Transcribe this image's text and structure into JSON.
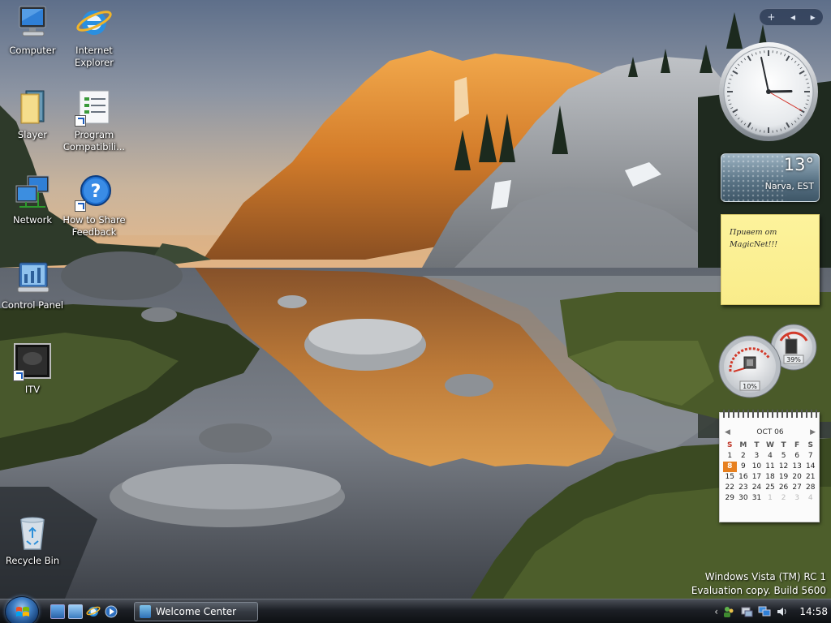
{
  "desktop": {
    "icons": [
      {
        "label": "Computer",
        "icon": "computer-icon"
      },
      {
        "label": "Internet\nExplorer",
        "icon": "internet-explorer-icon"
      },
      {
        "label": "Slayer",
        "icon": "folder-icon"
      },
      {
        "label": "Program\nCompatibili...",
        "icon": "program-compatibility-icon"
      },
      {
        "label": "Network",
        "icon": "network-icon"
      },
      {
        "label": "How to Share\nFeedback",
        "icon": "help-icon"
      },
      {
        "label": "Control Panel",
        "icon": "control-panel-icon"
      },
      {
        "label": "ITV",
        "icon": "tv-icon"
      },
      {
        "label": "Recycle Bin",
        "icon": "recycle-bin-icon"
      }
    ],
    "watermark": {
      "line1": "Windows Vista (TM) RC 1",
      "line2": "Evaluation copy. Build 5600"
    }
  },
  "sidebar": {
    "controls": {
      "add": "+",
      "prev": "◂",
      "next": "▸"
    },
    "clock": {
      "hour": 2,
      "minute": 58,
      "second": 20
    },
    "weather": {
      "temperature": "13°",
      "location": "Narva, EST"
    },
    "notes": {
      "text": "Привет от MagicNet!!!"
    },
    "cpu_meter": {
      "cpu": "10%",
      "memory": "39%"
    },
    "calendar": {
      "month": "OCT 06",
      "days_of_week": [
        "S",
        "M",
        "T",
        "W",
        "T",
        "F",
        "S"
      ],
      "weeks": [
        [
          "1",
          "2",
          "3",
          "4",
          "5",
          "6",
          "7"
        ],
        [
          "8",
          "9",
          "10",
          "11",
          "12",
          "13",
          "14"
        ],
        [
          "15",
          "16",
          "17",
          "18",
          "19",
          "20",
          "21"
        ],
        [
          "22",
          "23",
          "24",
          "25",
          "26",
          "27",
          "28"
        ],
        [
          "29",
          "30",
          "31",
          "1",
          "2",
          "3",
          "4"
        ]
      ],
      "today": "8"
    }
  },
  "taskbar": {
    "tasks": [
      {
        "label": "Welcome Center"
      }
    ],
    "tray": {
      "time": "14:58"
    }
  },
  "colors": {
    "taskbar": "#1d2026",
    "note": "#fdf39c",
    "calendar_today": "#e7801f"
  }
}
